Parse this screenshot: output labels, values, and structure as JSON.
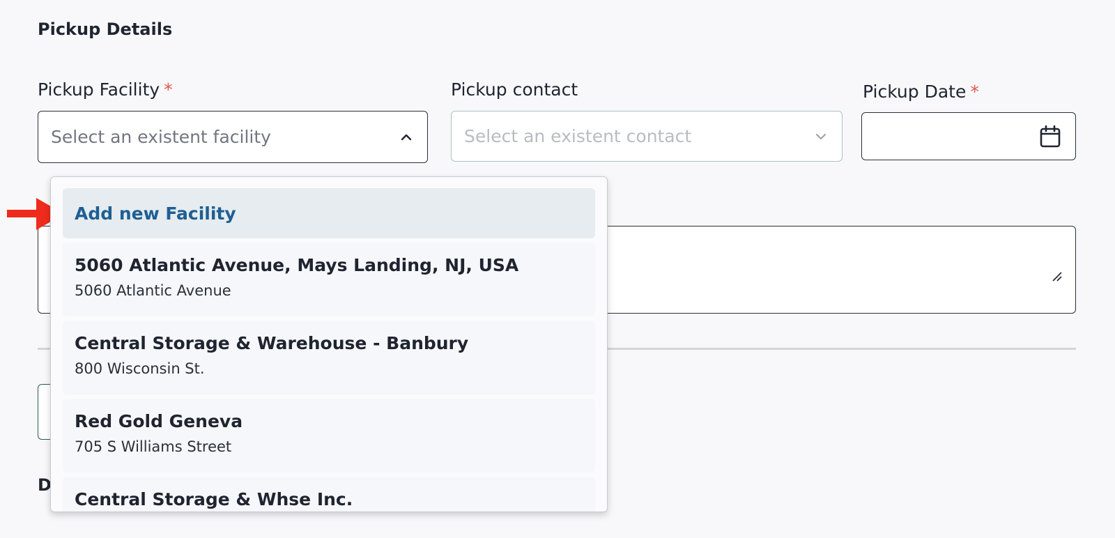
{
  "section": {
    "title": "Pickup Details",
    "next_heading_partial": "D"
  },
  "pickup_facility": {
    "label": "Pickup Facility",
    "required_mark": "*",
    "placeholder": "Select an existent facility",
    "icon": "chevron-up-icon"
  },
  "pickup_contact": {
    "label": "Pickup contact",
    "placeholder": "Select an existent contact",
    "icon": "chevron-down-icon",
    "disabled": true
  },
  "pickup_date": {
    "label": "Pickup Date",
    "required_mark": "*",
    "value": "",
    "icon": "calendar-icon"
  },
  "facility_dropdown": {
    "add_label": "Add new Facility",
    "options": [
      {
        "title": "5060 Atlantic Avenue, Mays Landing, NJ, USA",
        "subtitle": "5060 Atlantic Avenue"
      },
      {
        "title": "Central Storage & Warehouse - Banbury",
        "subtitle": "800 Wisconsin St."
      },
      {
        "title": "Red Gold Geneva",
        "subtitle": "705 S Williams Street"
      },
      {
        "title": "Central Storage & Whse Inc.",
        "subtitle": ""
      }
    ]
  },
  "colors": {
    "accent_link": "#1f5f93",
    "required": "#e0564a",
    "arrow": "#ee2b1c",
    "highlight_bg": "#e6ecef"
  }
}
